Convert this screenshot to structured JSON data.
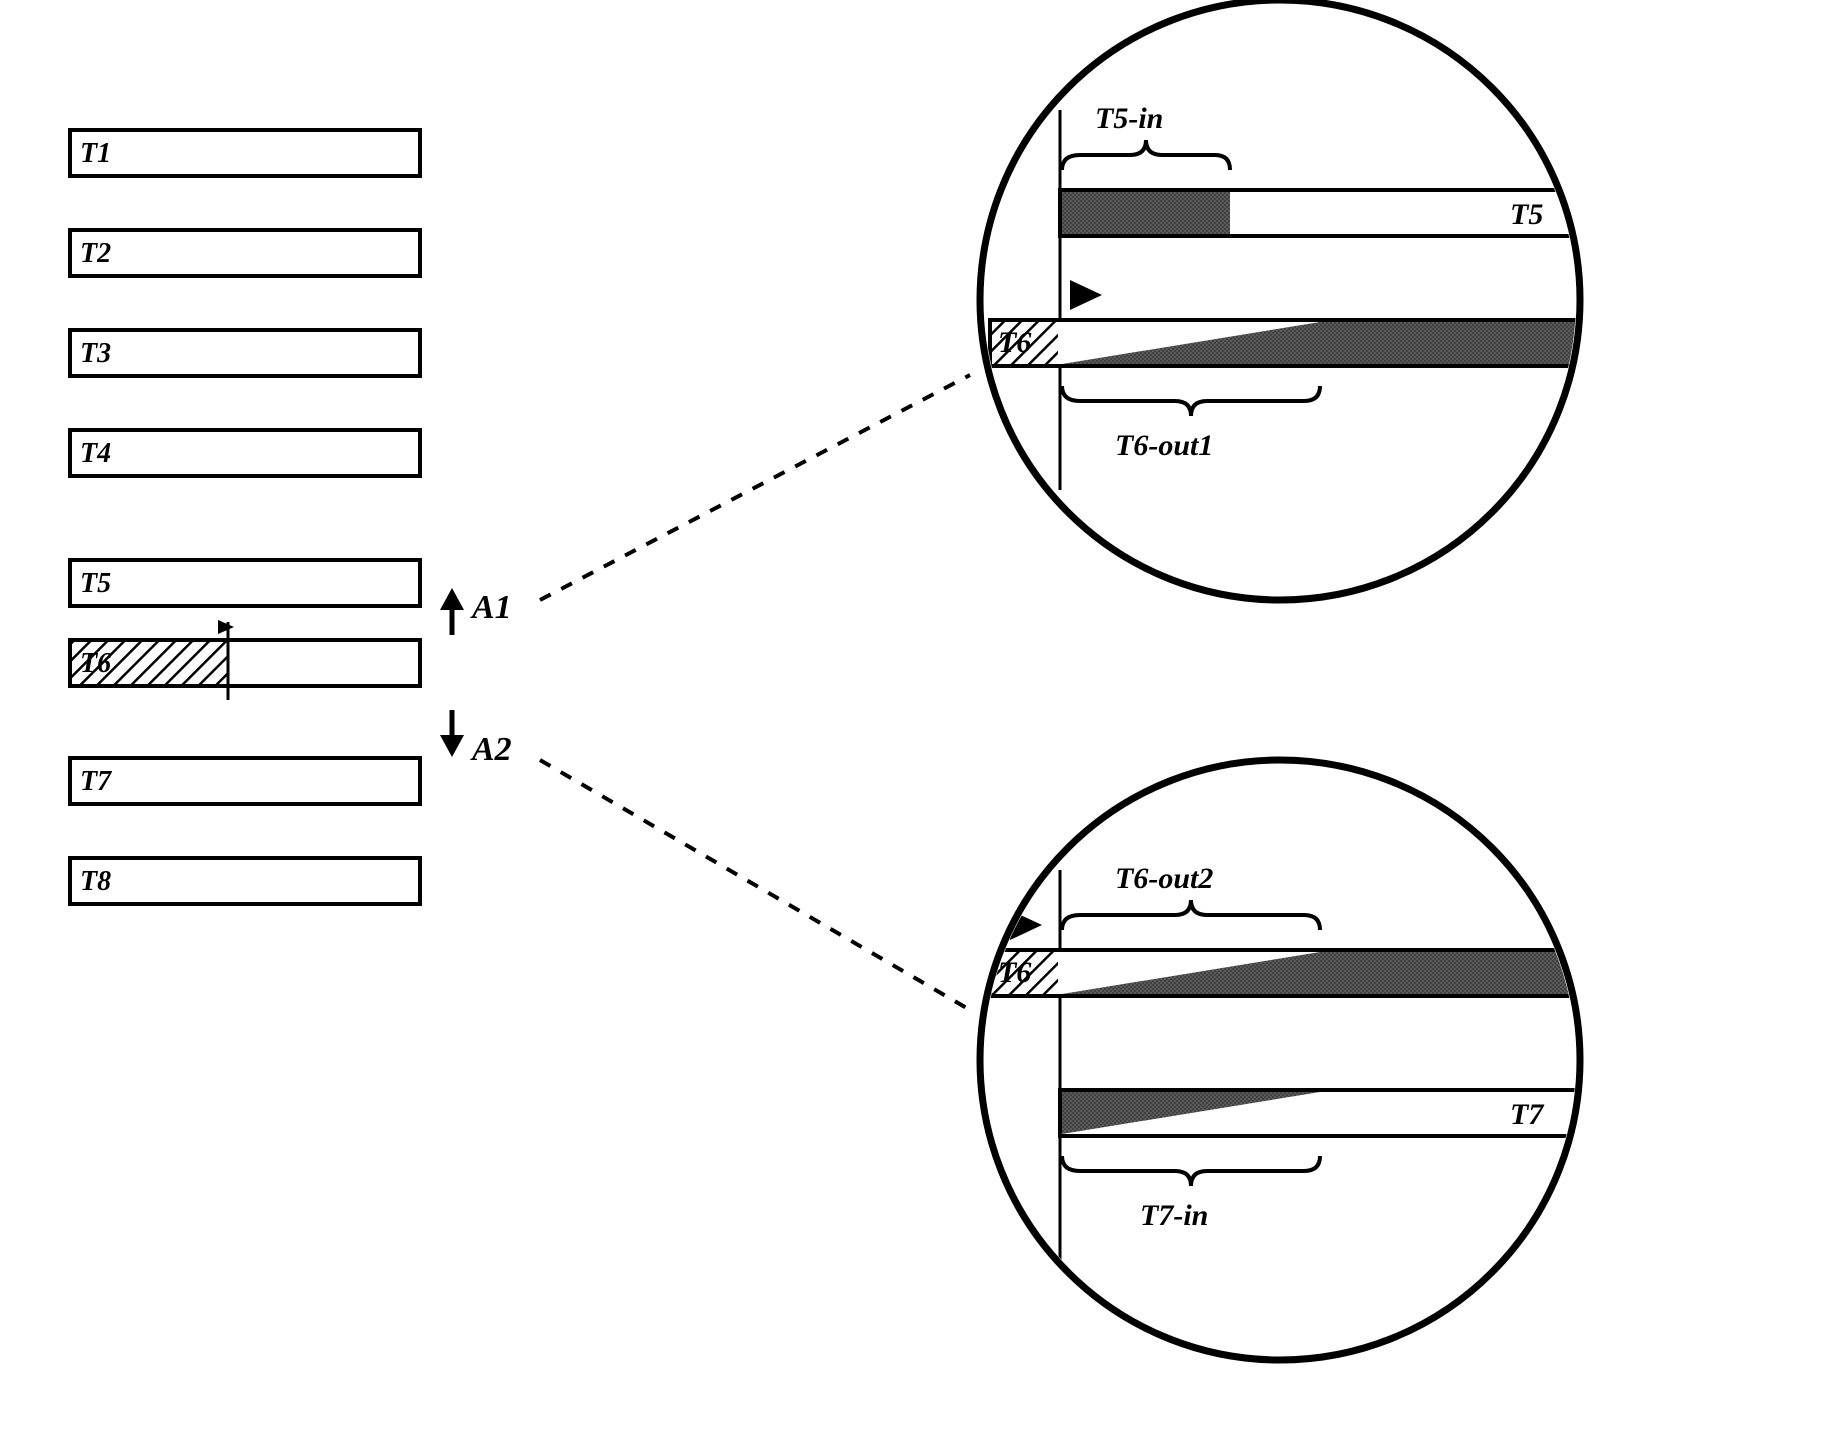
{
  "tracks": {
    "t1": "T1",
    "t2": "T2",
    "t3": "T3",
    "t4": "T4",
    "t5": "T5",
    "t6": "T6",
    "t7": "T7",
    "t8": "T8"
  },
  "annotations": {
    "a1": "A1",
    "a2": "A2"
  },
  "zoom1": {
    "in_label": "T5-in",
    "top_track": "T5",
    "bottom_track": "T6",
    "out_label": "T6-out1"
  },
  "zoom2": {
    "out_label": "T6-out2",
    "top_track": "T6",
    "bottom_track": "T7",
    "in_label": "T7-in"
  }
}
